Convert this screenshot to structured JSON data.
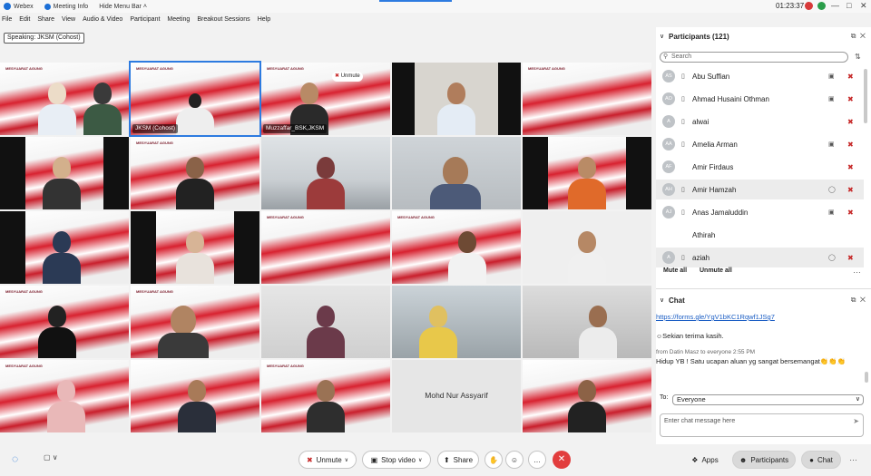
{
  "titlebar": {
    "app_name": "Webex",
    "meeting_info": "Meeting Info",
    "hide_menu": "Hide Menu Bar ˄",
    "time": "01:23:37",
    "minimize": "—",
    "maximize": "□",
    "close": "✕"
  },
  "menu": [
    "File",
    "Edit",
    "Share",
    "View",
    "Audio & Video",
    "Participant",
    "Meeting",
    "Breakout Sessions",
    "Help"
  ],
  "speaking": "Speaking: JKSM (Cohost)",
  "tiles": {
    "banner_heading": "MESYUARAT AGUNG",
    "jksm_label": "JKSM (Cohost)",
    "muzzaffar_label": "Muzzaffar_BSK,JKSM",
    "unmute_chip": "Unmute",
    "mohd_nur": "Mohd Nur Assyarif"
  },
  "participants": {
    "title": "Participants (121)",
    "search_placeholder": "Search",
    "items": [
      {
        "initials": "AS",
        "name": "Abu Suffian"
      },
      {
        "initials": "AO",
        "name": "Ahmad Husaini Othman"
      },
      {
        "initials": "A",
        "name": "alwai"
      },
      {
        "initials": "AA",
        "name": "Amelia Arman"
      },
      {
        "initials": "AF",
        "name": "Amir Firdaus"
      },
      {
        "initials": "AH",
        "name": "Amir Hamzah"
      },
      {
        "initials": "AJ",
        "name": "Anas Jamaluddin"
      },
      {
        "initials": "",
        "name": "Athirah"
      },
      {
        "initials": "A",
        "name": "aziah"
      }
    ],
    "mute_all": "Mute all",
    "unmute_all": "Unmute all"
  },
  "chat": {
    "title": "Chat",
    "link": "https://forms.gle/YgV1bKC1Rqwf1JSg7",
    "msg1": "Sekian terima kasih.",
    "meta": "from Datin Masz to everyone    2:55 PM",
    "msg2": "Hidup YB ! Satu ucapan aluan yg sangat bersemangat👏👏👏",
    "to_label": "To:",
    "to_value": "Everyone",
    "input_placeholder": "Enter chat message here"
  },
  "controls": {
    "unmute": "Unmute",
    "stop_video": "Stop video",
    "share": "Share",
    "apps": "Apps",
    "participants": "Participants",
    "chat": "Chat"
  },
  "colors": {
    "accent": "#2d7be0",
    "leave": "#e23d3d",
    "muted": "#c62828"
  }
}
